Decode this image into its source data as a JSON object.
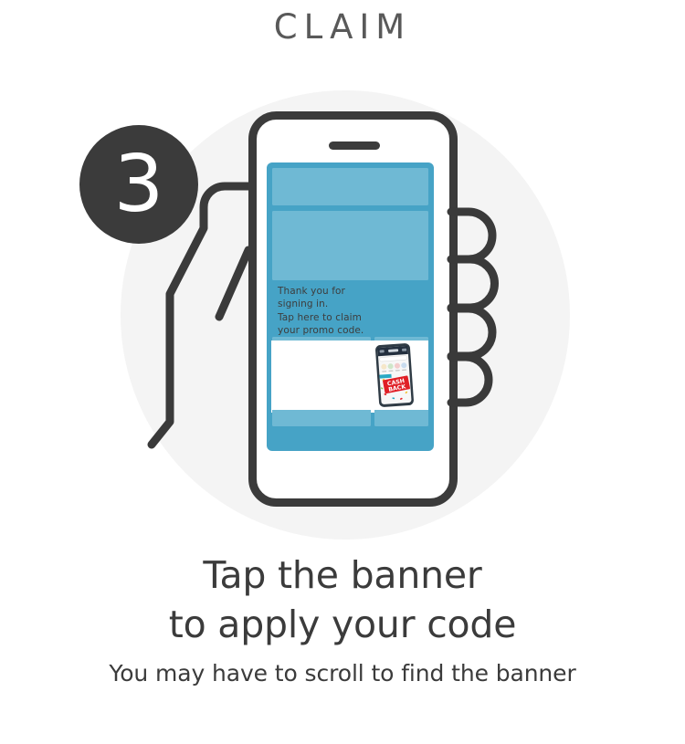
{
  "header": {
    "title": "CLAIM"
  },
  "illustration": {
    "step_badge": {
      "number": "3",
      "bg_color": "#3b3b3b",
      "text_color": "#ffffff"
    },
    "backdrop_circle_color": "#f4f4f4",
    "hand": {
      "stroke_color": "#3a3a3a",
      "finger_count": 4,
      "name": "hand-holding-phone"
    },
    "phone": {
      "body_color": "#ffffff",
      "frame_color": "#3b3b3b",
      "speaker_color": "#3b3b3b",
      "screen": {
        "panel_color": "#46a3c6",
        "block_color": "#6fb9d4",
        "blocks": [
          {
            "name": "content-block-top",
            "label": ""
          },
          {
            "name": "content-block-hero",
            "label": ""
          },
          {
            "name": "content-block-bottom-left",
            "label": ""
          },
          {
            "name": "content-block-bottom-right",
            "label": ""
          }
        ]
      },
      "banner": {
        "background": "#ffffff",
        "message_lines": [
          "Thank you for",
          "signing in.",
          "Tap here to claim",
          "your promo code."
        ],
        "thumbnail": {
          "name": "promo-phone-thumbnail",
          "badge_text_line1": "CASH",
          "badge_text_line2": "BACK",
          "badge_color": "#e01f26",
          "badge_text_color": "#ffffff",
          "screen_header_color": "#232f3e",
          "screen_body_color": "#f7f7f7"
        }
      }
    }
  },
  "footer": {
    "headline_line1": "Tap the banner",
    "headline_line2": "to apply your code",
    "subline": "You may have to scroll to find the banner"
  }
}
